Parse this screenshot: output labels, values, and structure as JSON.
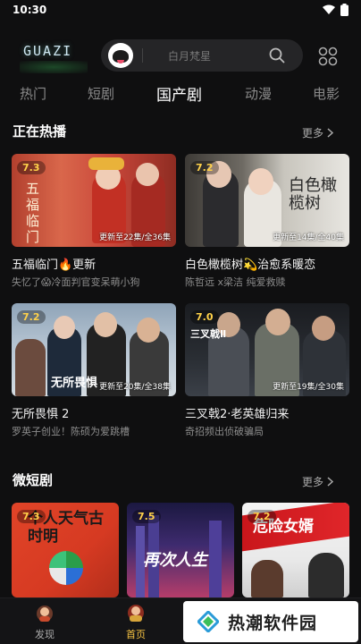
{
  "status": {
    "time": "10:30"
  },
  "header": {
    "logo": "GUAZI",
    "search_placeholder": "白月梵星"
  },
  "tabs": [
    {
      "label": "热门",
      "active": false
    },
    {
      "label": "短剧",
      "active": false
    },
    {
      "label": "国产剧",
      "active": true
    },
    {
      "label": "动漫",
      "active": false
    },
    {
      "label": "电影",
      "active": false
    }
  ],
  "sections": {
    "hot": {
      "title": "正在热播",
      "more": "更多"
    },
    "micro": {
      "title": "微短剧",
      "more": "更多"
    }
  },
  "hot_items": [
    {
      "rating": "7.3",
      "progress": "更新至22集/全36集",
      "title": "五福临门🔥更新",
      "subtitle": "失忆了😱冷面判官变呆萌小狗",
      "poster_text": "五福临门"
    },
    {
      "rating": "7.2",
      "progress": "更新至14集/全40集",
      "title": "白色橄榄树💫治愈系暖恋",
      "subtitle": "陈哲远 x梁洁  纯爱救赎",
      "poster_text": "白色橄榄树"
    },
    {
      "rating": "7.2",
      "progress": "更新至20集/全38集",
      "title": "无所畏惧 2",
      "subtitle": "罗英子创业！陈硕为爱跳槽",
      "poster_text": "无所畏惧"
    },
    {
      "rating": "7.0",
      "progress": "更新至19集/全30集",
      "title": "三叉戟2·老英雄归来",
      "subtitle": "奇招频出侦破骗局",
      "poster_text": "三叉戟Ⅱ"
    }
  ],
  "micro_items": [
    {
      "rating": "7.3",
      "poster_text": "个人天气古时明"
    },
    {
      "rating": "7.5",
      "poster_text": "再次人生"
    },
    {
      "rating": "7.2",
      "poster_text": "危险女婿"
    }
  ],
  "bottom_nav": [
    {
      "label": "发现",
      "active": false
    },
    {
      "label": "首页",
      "active": true
    }
  ],
  "watermark": {
    "text": "热潮软件园"
  },
  "colors": {
    "accent_active": "#f5c242",
    "rating": "#ffd24a",
    "background": "#0f0f10"
  }
}
